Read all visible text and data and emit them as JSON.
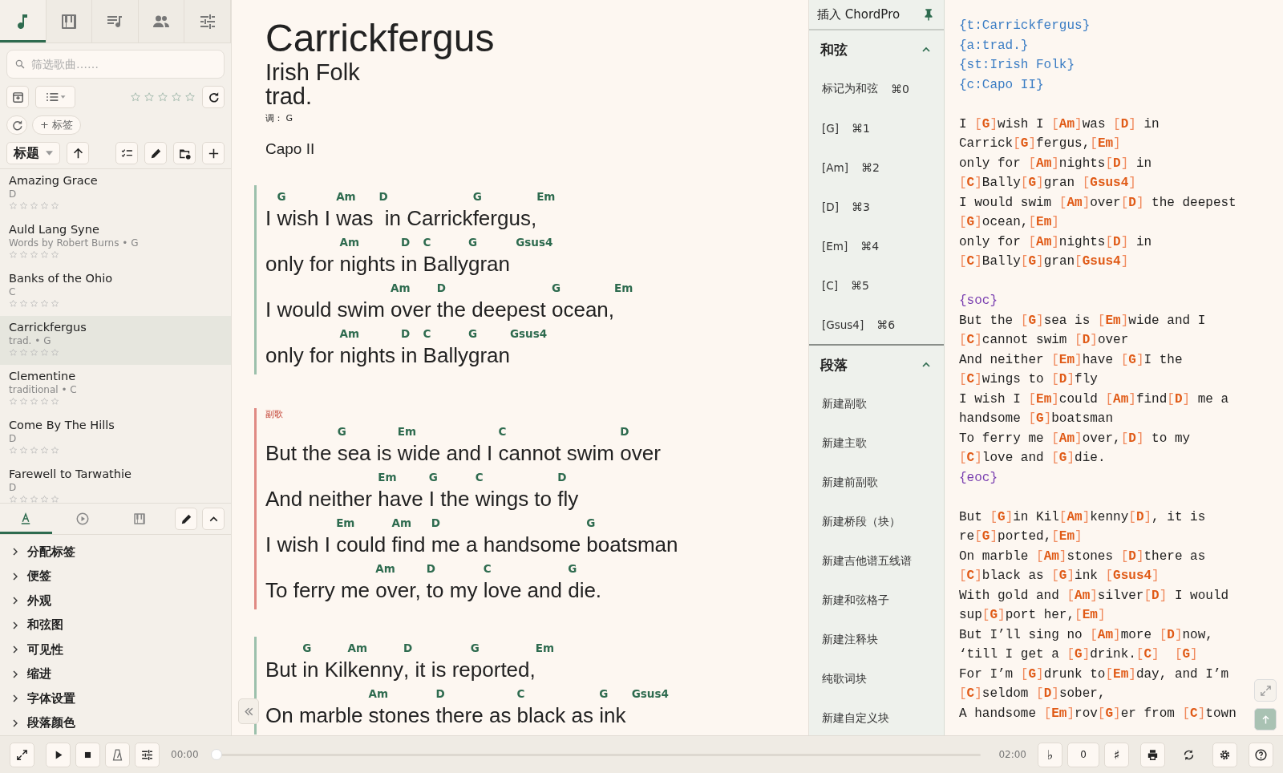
{
  "nav_tabs": [
    {
      "selected": true
    },
    {
      "selected": false
    },
    {
      "selected": false
    },
    {
      "selected": false
    },
    {
      "selected": false
    }
  ],
  "search": {
    "placeholder": "筛选歌曲……"
  },
  "filter": {
    "stars": 0
  },
  "tag_button": "+ 标签",
  "sort": {
    "label": "标题"
  },
  "songs": [
    {
      "title": "Amazing Grace",
      "subtitle": "D",
      "stars": 0,
      "selected": false
    },
    {
      "title": "Auld Lang Syne",
      "subtitle": "Words by Robert Burns • G",
      "stars": 0,
      "selected": false
    },
    {
      "title": "Banks of the Ohio",
      "subtitle": "C",
      "stars": 0,
      "selected": false
    },
    {
      "title": "Carrickfergus",
      "subtitle": "trad. • G",
      "stars": 0,
      "selected": true
    },
    {
      "title": "Clementine",
      "subtitle": "traditional • C",
      "stars": 0,
      "selected": false
    },
    {
      "title": "Come By The Hills",
      "subtitle": "D",
      "stars": 0,
      "selected": false
    },
    {
      "title": "Farewell to Tarwathie",
      "subtitle": "D",
      "stars": 0,
      "selected": false
    }
  ],
  "panel_tabs": [
    {
      "selected": true
    },
    {
      "selected": false
    },
    {
      "selected": false
    }
  ],
  "settings_sections": [
    {
      "label": "分配标签",
      "expanded": false
    },
    {
      "label": "便签",
      "expanded": false
    },
    {
      "label": "外观",
      "expanded": false
    },
    {
      "label": "和弦图",
      "expanded": false
    },
    {
      "label": "可见性",
      "expanded": false
    },
    {
      "label": "缩进",
      "expanded": false
    },
    {
      "label": "字体设置",
      "expanded": false
    },
    {
      "label": "段落颜色",
      "expanded": false
    }
  ],
  "song": {
    "title": "Carrickfergus",
    "subtitle": "Irish Folk",
    "artist": "trad.",
    "key_label": "调：",
    "key": "G",
    "capo": "Capo II",
    "sections": [
      {
        "kind": "verse",
        "lines": [
          [
            {
              "text": "I "
            },
            {
              "chord": "G",
              "text": "wish I "
            },
            {
              "chord": "Am",
              "text": "was "
            },
            {
              "chord": "D",
              "text": " in Carrick"
            },
            {
              "chord": "G",
              "text": "fergus,"
            },
            {
              "chord": "Em"
            }
          ],
          [
            {
              "text": "only for "
            },
            {
              "chord": "Am",
              "text": "nights "
            },
            {
              "chord": "D",
              "text": "in "
            },
            {
              "chord": "C",
              "text": "Bally"
            },
            {
              "chord": "G",
              "text": "gran "
            },
            {
              "chord": "Gsus4"
            }
          ],
          [
            {
              "text": "I would swim "
            },
            {
              "chord": "Am",
              "text": "over "
            },
            {
              "chord": "D",
              "text": "the deepest "
            },
            {
              "chord": "G",
              "text": "ocean,"
            },
            {
              "chord": "Em"
            }
          ],
          [
            {
              "text": "only for "
            },
            {
              "chord": "Am",
              "text": "nights "
            },
            {
              "chord": "D",
              "text": "in "
            },
            {
              "chord": "C",
              "text": "Bally"
            },
            {
              "chord": "G",
              "text": "gran"
            },
            {
              "chord": "Gsus4"
            }
          ]
        ]
      },
      {
        "kind": "chorus",
        "label": "副歌",
        "lines": [
          [
            {
              "text": "But the "
            },
            {
              "chord": "G",
              "text": "sea is "
            },
            {
              "chord": "Em",
              "text": "wide and I "
            },
            {
              "chord": "C",
              "text": "cannot swim "
            },
            {
              "chord": "D",
              "text": "over"
            }
          ],
          [
            {
              "text": "And neither "
            },
            {
              "chord": "Em",
              "text": "have "
            },
            {
              "chord": "G",
              "text": "I the "
            },
            {
              "chord": "C",
              "text": "wings to "
            },
            {
              "chord": "D",
              "text": "fly"
            }
          ],
          [
            {
              "text": "I wish I "
            },
            {
              "chord": "Em",
              "text": "could "
            },
            {
              "chord": "Am",
              "text": "find "
            },
            {
              "chord": "D",
              "text": "me a handsome "
            },
            {
              "chord": "G",
              "text": "boatsman"
            }
          ],
          [
            {
              "text": "To ferry me "
            },
            {
              "chord": "Am",
              "text": "over, "
            },
            {
              "chord": "D",
              "text": "to my "
            },
            {
              "chord": "C",
              "text": "love and "
            },
            {
              "chord": "G",
              "text": "die."
            }
          ]
        ]
      },
      {
        "kind": "verse",
        "lines": [
          [
            {
              "text": "But "
            },
            {
              "chord": "G",
              "text": "in Kil"
            },
            {
              "chord": "Am",
              "text": "kenny"
            },
            {
              "chord": "D",
              "text": ", it is re"
            },
            {
              "chord": "G",
              "text": "ported,"
            },
            {
              "chord": "Em"
            }
          ],
          [
            {
              "text": "On marble "
            },
            {
              "chord": "Am",
              "text": "stones "
            },
            {
              "chord": "D",
              "text": "there as "
            },
            {
              "chord": "C",
              "text": "black as "
            },
            {
              "chord": "G",
              "text": "ink "
            },
            {
              "chord": "Gsus4"
            }
          ]
        ]
      }
    ]
  },
  "insert_panel": {
    "title": "插入 ChordPro",
    "groups": [
      {
        "title": "和弦",
        "expanded": true,
        "items": [
          {
            "label": "标记为和弦",
            "shortcut": "⌘0"
          },
          {
            "label": "[G]",
            "shortcut": "⌘1"
          },
          {
            "label": "[Am]",
            "shortcut": "⌘2"
          },
          {
            "label": "[D]",
            "shortcut": "⌘3"
          },
          {
            "label": "[Em]",
            "shortcut": "⌘4"
          },
          {
            "label": "[C]",
            "shortcut": "⌘5"
          },
          {
            "label": "[Gsus4]",
            "shortcut": "⌘6"
          }
        ]
      },
      {
        "title": "段落",
        "expanded": true,
        "items": [
          {
            "label": "新建副歌"
          },
          {
            "label": "新建主歌"
          },
          {
            "label": "新建前副歌"
          },
          {
            "label": "新建桥段（块）"
          },
          {
            "label": "新建吉他谱五线谱"
          },
          {
            "label": "新建和弦格子"
          },
          {
            "label": "新建注释块"
          },
          {
            "label": "纯歌词块"
          },
          {
            "label": "新建自定义块"
          }
        ]
      }
    ]
  },
  "source": [
    [
      {
        "kind": "meta",
        "text": "{t:Carrickfergus}"
      },
      {
        "kind": "meta",
        "text": "{a:trad.}"
      },
      {
        "kind": "meta",
        "text": "{st:Irish Folk}"
      },
      {
        "kind": "meta",
        "text": "{c:Capo II}"
      }
    ],
    [
      {
        "kind": "lyric",
        "text": "I [G]wish I [Am]was [D] in"
      },
      {
        "kind": "lyric",
        "text": "Carrick[G]fergus,[Em]"
      },
      {
        "kind": "lyric",
        "text": "only for [Am]nights[D] in"
      },
      {
        "kind": "lyric",
        "text": "[C]Bally[G]gran [Gsus4]"
      },
      {
        "kind": "lyric",
        "text": "I would swim [Am]over[D] the deepest"
      },
      {
        "kind": "lyric",
        "text": "[G]ocean,[Em]"
      },
      {
        "kind": "lyric",
        "text": "only for [Am]nights[D] in"
      },
      {
        "kind": "lyric",
        "text": "[C]Bally[G]gran[Gsus4]"
      }
    ],
    [
      {
        "kind": "env",
        "text": "{soc}"
      },
      {
        "kind": "lyric",
        "text": "But the [G]sea is [Em]wide and I"
      },
      {
        "kind": "lyric",
        "text": "[C]cannot swim [D]over"
      },
      {
        "kind": "lyric",
        "text": "And neither [Em]have [G]I the"
      },
      {
        "kind": "lyric",
        "text": "[C]wings to [D]fly"
      },
      {
        "kind": "lyric",
        "text": "I wish I [Em]could [Am]find[D] me a"
      },
      {
        "kind": "lyric",
        "text": "handsome [G]boatsman"
      },
      {
        "kind": "lyric",
        "text": "To ferry me [Am]over,[D] to my"
      },
      {
        "kind": "lyric",
        "text": "[C]love and [G]die."
      },
      {
        "kind": "env",
        "text": "{eoc}"
      }
    ],
    [
      {
        "kind": "lyric",
        "text": "But [G]in Kil[Am]kenny[D], it is"
      },
      {
        "kind": "lyric",
        "text": "re[G]ported,[Em]"
      },
      {
        "kind": "lyric",
        "text": "On marble [Am]stones [D]there as"
      },
      {
        "kind": "lyric",
        "text": "[C]black as [G]ink [Gsus4]"
      },
      {
        "kind": "lyric",
        "text": "With gold and [Am]silver[D] I would"
      },
      {
        "kind": "lyric",
        "text": "sup[G]port her,[Em]"
      },
      {
        "kind": "lyric",
        "text": "But I’ll sing no [Am]more [D]now,"
      },
      {
        "kind": "lyric",
        "text": "‘till I get a [G]drink.[C]  [G]"
      },
      {
        "kind": "lyric",
        "text": "For I’m [G]drunk to[Em]day, and I’m"
      },
      {
        "kind": "lyric",
        "text": "[C]seldom [D]sober,"
      },
      {
        "kind": "lyric",
        "text": "A handsome [Em]rov[G]er from [C]town"
      }
    ]
  ],
  "player": {
    "elapsed": "00:00",
    "total": "02:00",
    "level": 0,
    "flat": "♭",
    "transpose": "0",
    "sharp": "♯"
  }
}
